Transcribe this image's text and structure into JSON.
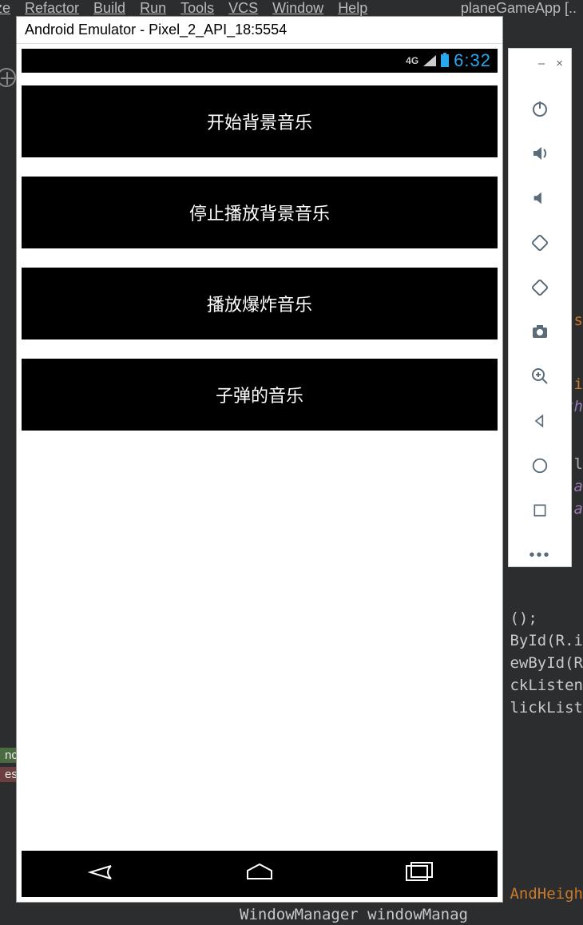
{
  "ide": {
    "menu": [
      "ze",
      "Refactor",
      "Build",
      "Run",
      "Tools",
      "VCS",
      "Window",
      "Help"
    ],
    "title_right": "planeGameApp [..",
    "code_lines": [
      {
        "text": "();",
        "cls": ""
      },
      {
        "text": "",
        "cls": ""
      },
      {
        "text": "",
        "cls": ""
      },
      {
        "text": "ById(R.i",
        "cls": ""
      },
      {
        "text": "ewById(R",
        "cls": ""
      },
      {
        "text": "",
        "cls": ""
      },
      {
        "text": "ckListen",
        "cls": ""
      },
      {
        "text": "lickList",
        "cls": ""
      },
      {
        "text": "",
        "cls": ""
      }
    ],
    "code_bottom": "WindowManager windowManag",
    "peek_s": "s",
    "peek_i": "i",
    "peek_th": "th",
    "peek_l": "l",
    "peek_a": "a",
    "peek_a2": "a",
    "peek_andheigh": "AndHeigh",
    "tab_nc": "nc",
    "tab_es": "es"
  },
  "emulator": {
    "title": "Android Emulator - Pixel_2_API_18:5554",
    "statusbar": {
      "net": "4G",
      "time": "6:32"
    },
    "buttons": [
      "开始背景音乐",
      "停止播放背景音乐",
      "播放爆炸音乐",
      "子弹的音乐"
    ],
    "sidebar_min": "–",
    "sidebar_close": "×"
  }
}
